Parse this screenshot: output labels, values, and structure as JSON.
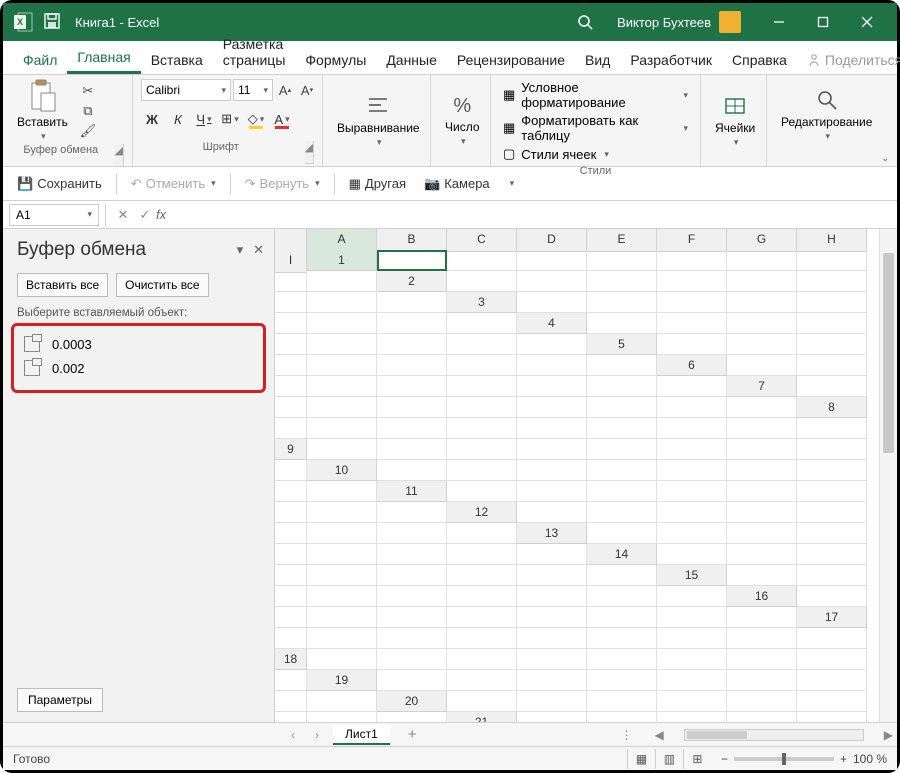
{
  "titlebar": {
    "title": "Книга1 - Excel",
    "user": "Виктор Бухтеев"
  },
  "tabs": {
    "file": "Файл",
    "items": [
      "Главная",
      "Вставка",
      "Разметка страницы",
      "Формулы",
      "Данные",
      "Рецензирование",
      "Вид",
      "Разработчик",
      "Справка"
    ],
    "share": "Поделиться"
  },
  "ribbon": {
    "clipboard": {
      "paste": "Вставить",
      "label": "Буфер обмена"
    },
    "font": {
      "name": "Calibri",
      "size": "11",
      "label": "Шрифт"
    },
    "align": {
      "btn": "Выравнивание"
    },
    "number": {
      "btn": "Число"
    },
    "styles": {
      "cond": "Условное форматирование",
      "table": "Форматировать как таблицу",
      "cell": "Стили ячеек",
      "label": "Стили"
    },
    "cells": {
      "btn": "Ячейки"
    },
    "editing": {
      "btn": "Редактирование"
    }
  },
  "qat": {
    "save": "Сохранить",
    "undo": "Отменить",
    "redo": "Вернуть",
    "other": "Другая",
    "camera": "Камера"
  },
  "formulabar": {
    "cellref": "A1"
  },
  "clipboard_panel": {
    "title": "Буфер обмена",
    "paste_all": "Вставить все",
    "clear_all": "Очистить все",
    "hint": "Выберите вставляемый объект:",
    "items": [
      "0.0003",
      "0.002"
    ],
    "params": "Параметры"
  },
  "grid": {
    "cols": [
      "A",
      "B",
      "C",
      "D",
      "E",
      "F",
      "G",
      "H",
      "I"
    ],
    "rows_count": 21,
    "active_cell": "A1"
  },
  "sheets": {
    "active": "Лист1"
  },
  "statusbar": {
    "status": "Готово",
    "zoom": "100 %"
  }
}
